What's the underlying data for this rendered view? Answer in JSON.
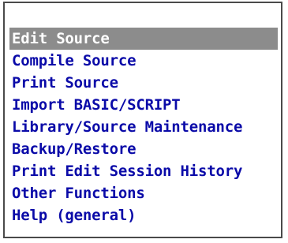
{
  "menu": {
    "items": [
      {
        "label": "Edit Source",
        "selected": true
      },
      {
        "label": "Compile Source",
        "selected": false
      },
      {
        "label": "Print Source",
        "selected": false
      },
      {
        "label": "Import BASIC/SCRIPT",
        "selected": false
      },
      {
        "label": "Library/Source Maintenance",
        "selected": false
      },
      {
        "label": "Backup/Restore",
        "selected": false
      },
      {
        "label": "Print Edit Session History",
        "selected": false
      },
      {
        "label": "Other Functions",
        "selected": false
      },
      {
        "label": "Help (general)",
        "selected": false
      }
    ]
  },
  "colors": {
    "text": "#0a0aa8",
    "highlight_bg": "#8c8c8c",
    "highlight_text": "#ffffff",
    "frame": "#4a4a4a",
    "panel_bg": "#ffffff"
  }
}
